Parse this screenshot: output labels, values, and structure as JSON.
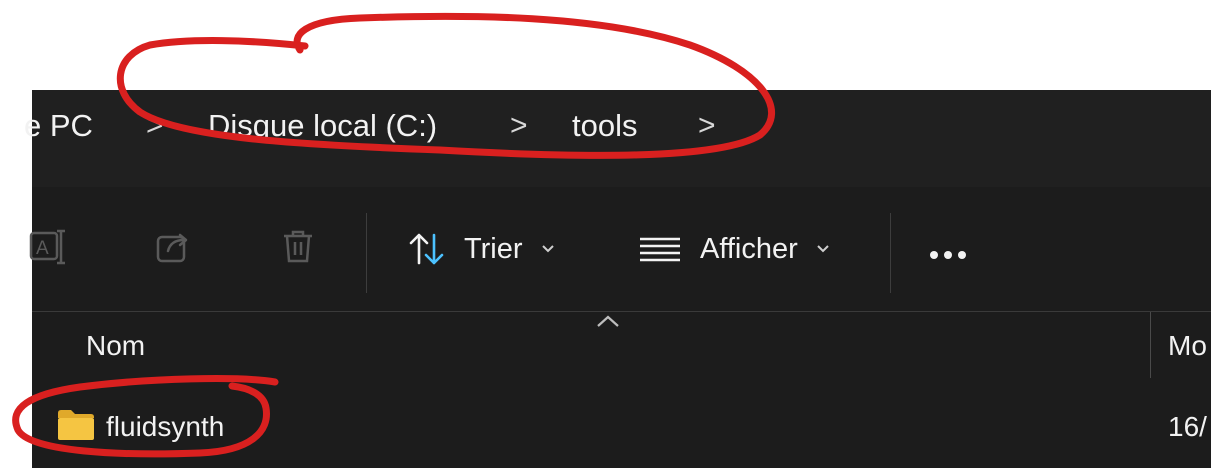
{
  "breadcrumb": {
    "items": [
      "e PC",
      "Disque local (C:)",
      "tools"
    ],
    "separator": ">"
  },
  "toolbar": {
    "sort_label": "Trier",
    "view_label": "Afficher",
    "icons": [
      "rename-icon",
      "share-icon",
      "delete-icon",
      "sort-icon",
      "view-lines-icon",
      "more-icon"
    ]
  },
  "columns": {
    "name_header": "Nom",
    "modified_header": "Mo"
  },
  "rows": [
    {
      "name": "fluidsynth",
      "date": "16/"
    }
  ],
  "colors": {
    "window_bg": "#1c1c1c",
    "addressbar_bg": "#202020",
    "text": "#f2f2f2",
    "accent_blue": "#4cc2ff",
    "folder_yellow": "#f5c542",
    "annotation_red": "#d9201f"
  }
}
